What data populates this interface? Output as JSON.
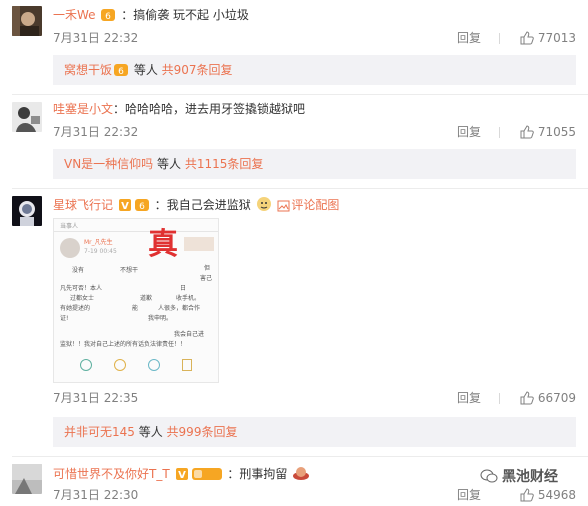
{
  "comments": [
    {
      "username": "一禾We",
      "separator": "：",
      "text": "搞偷袭 玩不起 小垃圾",
      "time": "7月31日 22:32",
      "reply_label": "回复",
      "likes": "77013",
      "sub": {
        "user": "窝想干饭",
        "middle": " 等人 ",
        "count_text": "共907条回复"
      }
    },
    {
      "username": "哇塞是小文",
      "separator": "：",
      "text": "哈哈哈哈，进去用牙签撬锁越狱吧",
      "time": "7月31日 22:32",
      "reply_label": "回复",
      "likes": "71055",
      "sub": {
        "user": "VN是一种信仰吗",
        "middle": " 等人 ",
        "count_text": "共1115条回复"
      }
    },
    {
      "username": "星球飞行记",
      "separator": "：",
      "text": "我自己会进监狱",
      "pic_label": "评论配图",
      "time": "7月31日 22:35",
      "reply_label": "回复",
      "likes": "66709",
      "sub": {
        "user": "并非可无145",
        "middle": " 等人 ",
        "count_text": "共999条回复"
      }
    },
    {
      "username": "可惜世界不及你好T_T",
      "separator": "：",
      "text": "刑事拘留",
      "time": "7月31日 22:30",
      "reply_label": "回复",
      "likes": "54968"
    }
  ],
  "image": {
    "header": "当事人",
    "name": "Mr_凡先生",
    "stamp": "真",
    "lines": [
      "没有",
      "不想干",
      "但",
      "害己",
      "凡先可否！本人",
      "日",
      "过都女士",
      "道歉",
      "收手机。",
      "有她提述的",
      "能",
      "人很多，都合作",
      "证!",
      "我申明。",
      "我会自己进",
      "监狱！！我对自己上述的所有话负法律责任！！"
    ]
  },
  "watermark": "黑池财经",
  "colors": {
    "accent": "#eb7350",
    "gray": "#808080",
    "sub_bg": "#f2f2f5"
  }
}
